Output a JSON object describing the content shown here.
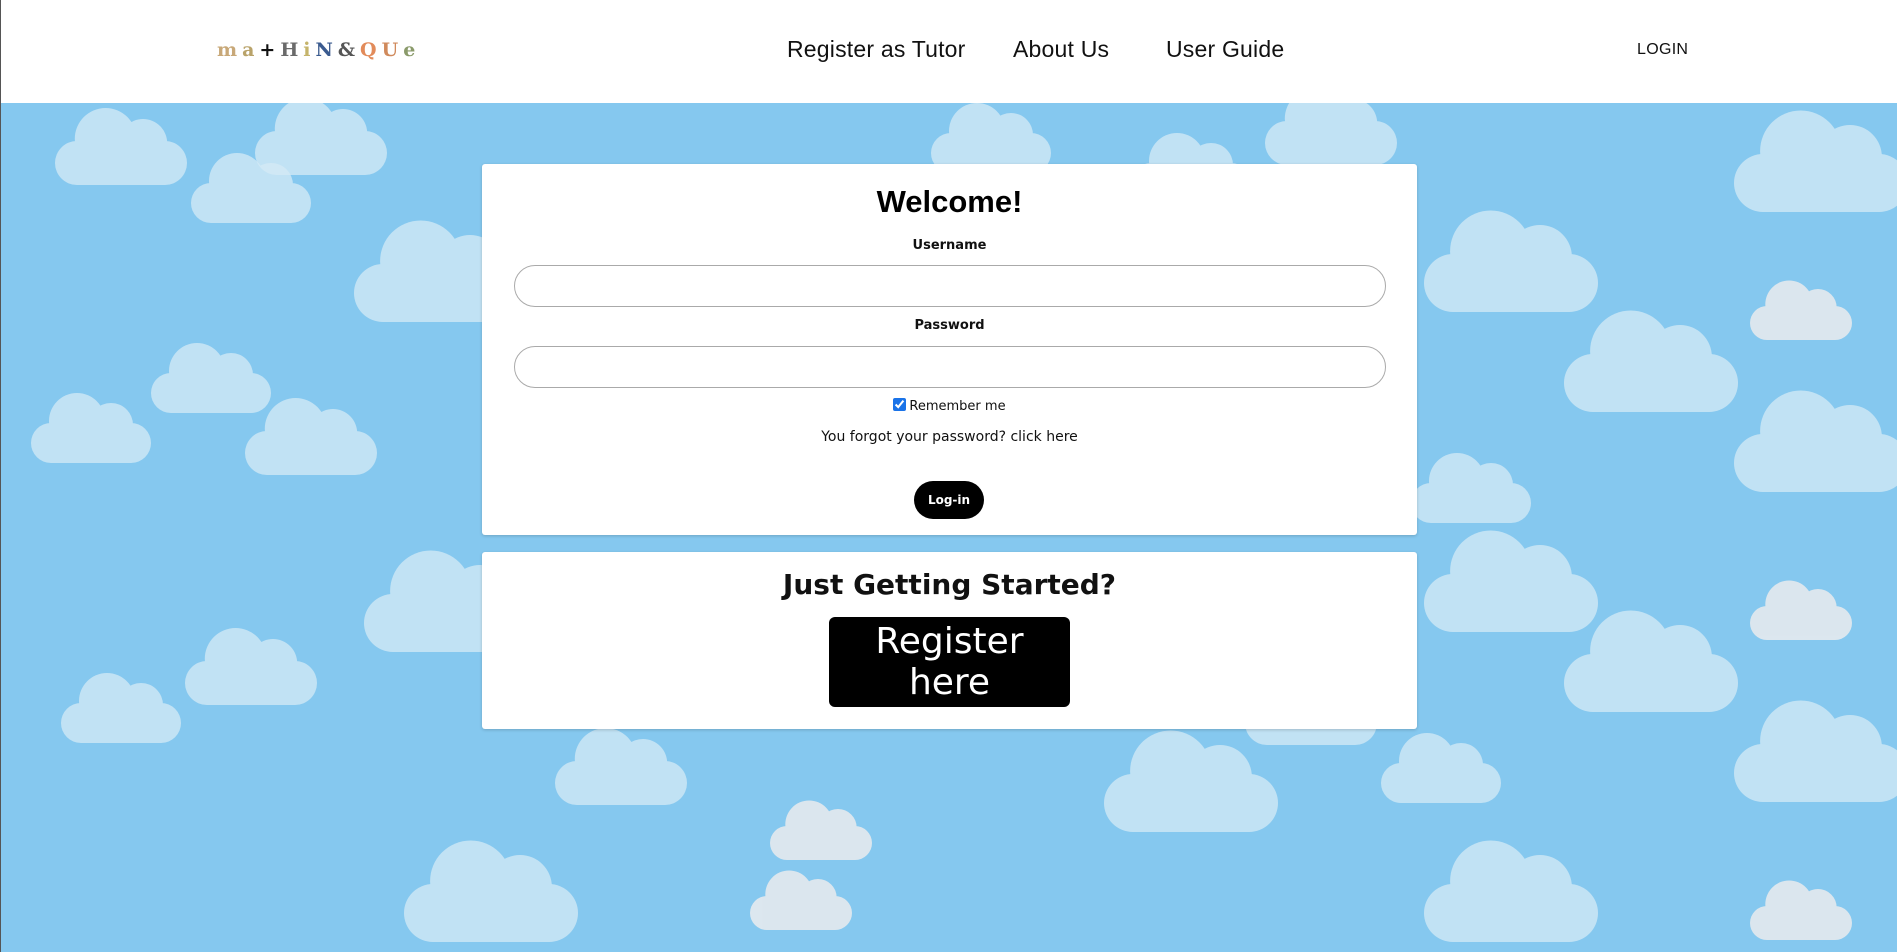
{
  "header": {
    "logo_letters": [
      "m",
      "a",
      "+",
      "H",
      "i",
      "N",
      "&",
      "Q",
      "U",
      "e"
    ],
    "logo_colors": [
      "#c8a878",
      "#b9a36a",
      "#111111",
      "#6a6a6a",
      "#c5b46b",
      "#3b5b8f",
      "#555555",
      "#e28b5a",
      "#d08a5c",
      "#8a9a6a"
    ],
    "nav": {
      "register_tutor": "Register as Tutor",
      "about_us": "About Us",
      "user_guide": "User Guide"
    },
    "login": "LOGIN"
  },
  "login_form": {
    "title": "Welcome!",
    "username_label": "Username",
    "username_value": "",
    "password_label": "Password",
    "password_value": "",
    "remember_label": "Remember me",
    "remember_checked": true,
    "forgot_text": "You forgot your password? click here",
    "submit_label": "Log-in"
  },
  "getting_started": {
    "title": "Just Getting Started?",
    "register_label": "Register here"
  },
  "colors": {
    "sky": "#85c8ef",
    "cloud": "#d6ebf6",
    "button": "#000000"
  }
}
